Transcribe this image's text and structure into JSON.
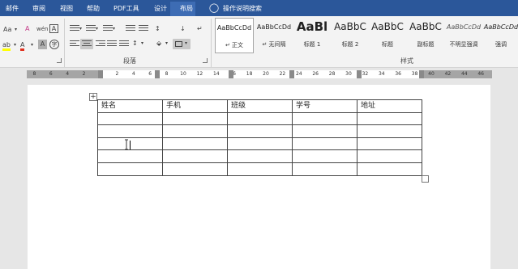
{
  "tabs": [
    {
      "label": "邮件",
      "active": false
    },
    {
      "label": "审阅",
      "active": false
    },
    {
      "label": "视图",
      "active": false
    },
    {
      "label": "帮助",
      "active": false
    },
    {
      "label": "PDF工具",
      "active": false
    },
    {
      "label": "设计",
      "active": false
    },
    {
      "label": "布局",
      "active": true
    }
  ],
  "tell_me": {
    "icon": "lightbulb-icon",
    "label": "操作说明搜索"
  },
  "font_group": {
    "change_case_label": "Aa",
    "clear_format_label": "A",
    "phonetic_label": "wén",
    "enclose_label": "A",
    "highlight_label": "ab",
    "font_color_label": "A",
    "char_shading_label": "A",
    "enclose_char_label": "字"
  },
  "paragraph_group": {
    "label": "段落"
  },
  "styles_group": {
    "label": "样式",
    "items": [
      {
        "sample": "AaBbCcDd",
        "name": "↵ 正文",
        "selected": true
      },
      {
        "sample": "AaBbCcDd",
        "name": "↵ 无间隔",
        "selected": false
      },
      {
        "sample": "AaBl",
        "name": "标题 1",
        "selected": false
      },
      {
        "sample": "AaBbC",
        "name": "标题 2",
        "selected": false
      },
      {
        "sample": "AaBbC",
        "name": "标题",
        "selected": false
      },
      {
        "sample": "AaBbC",
        "name": "副标题",
        "selected": false
      },
      {
        "sample": "AaBbCcDd",
        "name": "不明显强调",
        "selected": false
      },
      {
        "sample": "AaBbCcDd",
        "name": "强调",
        "selected": false
      }
    ]
  },
  "ruler": {
    "ticks": [
      "8",
      "6",
      "4",
      "2",
      "2",
      "4",
      "6",
      "8",
      "10",
      "12",
      "14",
      "16",
      "18",
      "20",
      "22",
      "24",
      "26",
      "28",
      "30",
      "32",
      "34",
      "36",
      "38",
      "40",
      "42",
      "44",
      "46"
    ]
  },
  "table": {
    "headers": [
      "姓名",
      "手机",
      "班级",
      "学号",
      "地址"
    ],
    "rows": [
      [
        "",
        "",
        "",
        "",
        ""
      ],
      [
        "",
        "",
        "",
        "",
        ""
      ],
      [
        "",
        "",
        "",
        "",
        ""
      ],
      [
        "",
        "",
        "",
        "",
        ""
      ],
      [
        "",
        "",
        "",
        "",
        ""
      ]
    ]
  },
  "colors": {
    "title_bar": "#2b579a",
    "active_tab": "#3d6cb4",
    "highlight": "#ffff00",
    "font_red": "#e0301e"
  }
}
